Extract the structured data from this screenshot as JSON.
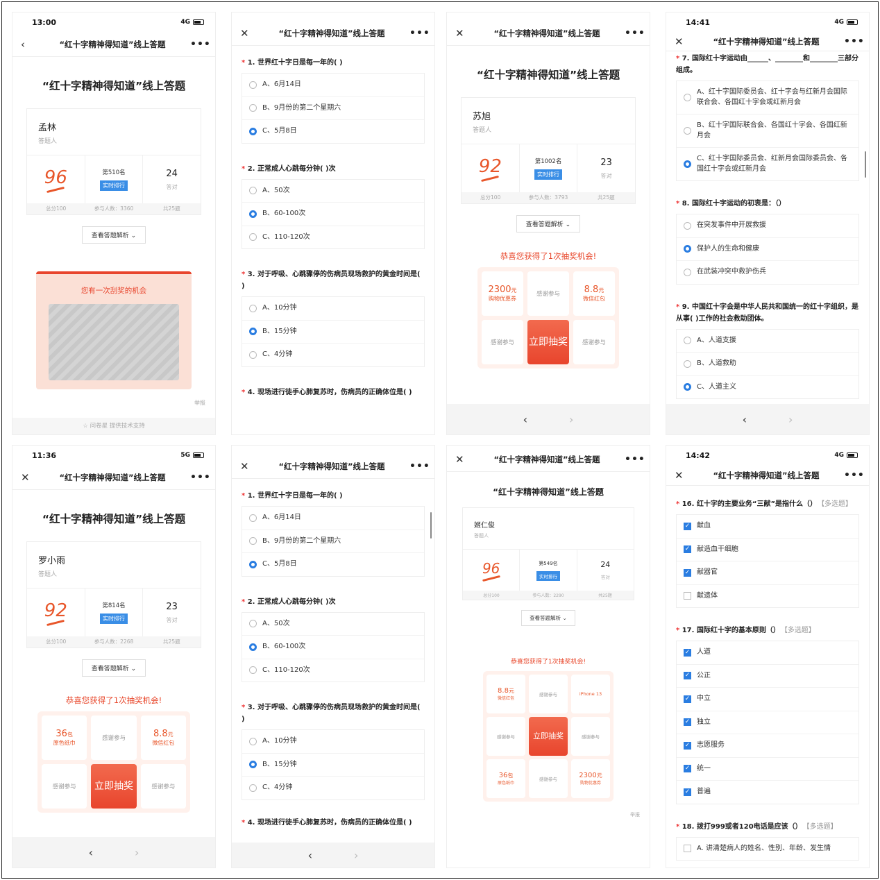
{
  "app_title": "“红十字精神得知道”线上答题",
  "status_times": [
    "13:00",
    "14:41",
    "11:36",
    "14:42"
  ],
  "networks": [
    "4G",
    "5G"
  ],
  "label_role": "答题人",
  "label_realtime": "实时排行",
  "label_total": "总分100",
  "label_count25": "共25题",
  "label_answered": "答对",
  "view_analysis": "查看答题解析",
  "prize_title": "恭喜您获得了1次抽奖机会!",
  "draw_button": "立即抽奖",
  "thanks": "感谢参与",
  "report": "举报",
  "users": [
    {
      "name": "孟林",
      "score": "96",
      "rank": "第510名",
      "participants": "参与人数：3360",
      "correct": "24"
    },
    {
      "name": "苏旭",
      "score": "92",
      "rank": "第1002名",
      "participants": "参与人数：3793",
      "correct": "23"
    },
    {
      "name": "罗小雨",
      "score": "92",
      "rank": "第814名",
      "participants": "参与人数：2268",
      "correct": "23"
    },
    {
      "name": "姬仁俊",
      "score": "96",
      "rank": "第549名",
      "participants": "参与人数：2290",
      "correct": "24"
    }
  ],
  "scratch_title": "您有一次刮奖的机会",
  "support": "问卷星 提供技术支持",
  "prizes": {
    "p2300": "2300",
    "p2300_unit": "元",
    "p2300_lbl": "购物优惠券",
    "p88": "8.8",
    "p88_unit": "元",
    "p88_lbl": "微信红包",
    "p36": "36",
    "p36_unit": "包",
    "p36_lbl": "原色纸巾",
    "iphone": "iPhone 13"
  },
  "q1": {
    "title": "1. 世界红十字日是每一年的( )",
    "opts": [
      "A、6月14日",
      "B、9月份的第二个星期六",
      "C、5月8日"
    ]
  },
  "q2": {
    "title": "2. 正常成人心跳每分钟( )次",
    "opts": [
      "A、50次",
      "B、60-100次",
      "C、110-120次"
    ]
  },
  "q3": {
    "title": "3. 对于呼吸、心跳骤停的伤病员现场救护的黄金时间是( )",
    "opts": [
      "A、10分钟",
      "B、15分钟",
      "C、4分钟"
    ]
  },
  "q4": {
    "title": "4. 现场进行徒手心肺复苏时，伤病员的正确体位是( )"
  },
  "q7": {
    "title": "7. 国际红十字运动由______、________和________三部分组成。",
    "opts": [
      "A、红十字国际委员会、红十字会与红新月会国际联合会、各国红十字会或红新月会",
      "B、红十字国际联合会、各国红十字会、各国红新月会",
      "C、红十字国际委员会、红新月会国际委员会、各国红十字会或红新月会"
    ]
  },
  "q8": {
    "title": "8. 国际红十字运动的初衷是：（）",
    "opts": [
      "在突发事件中开展救援",
      "保护人的生命和健康",
      "在武装冲突中救护伤兵"
    ]
  },
  "q9": {
    "title": "9. 中国红十字会是中华人民共和国统一的红十字组织，是从事( )工作的社会救助团体。",
    "opts": [
      "A、人道支援",
      "B、人道救助",
      "C、人道主义"
    ]
  },
  "q16": {
    "title": "16. 红十字的主要业务“三献”是指什么（）",
    "tag": "【多选题】",
    "opts": [
      "献血",
      "献造血干细胞",
      "献器官",
      "献遗体"
    ]
  },
  "q17": {
    "title": "17. 国际红十字的基本原则（）",
    "tag": "【多选题】",
    "opts": [
      "人道",
      "公正",
      "中立",
      "独立",
      "志愿服务",
      "统一",
      "普遍"
    ]
  },
  "q18": {
    "title": "18. 拨打999或者120电话是应该（）",
    "tag": "【多选题】",
    "opts": [
      "A. 讲清楚病人的姓名、性别、年龄、发生情"
    ]
  }
}
